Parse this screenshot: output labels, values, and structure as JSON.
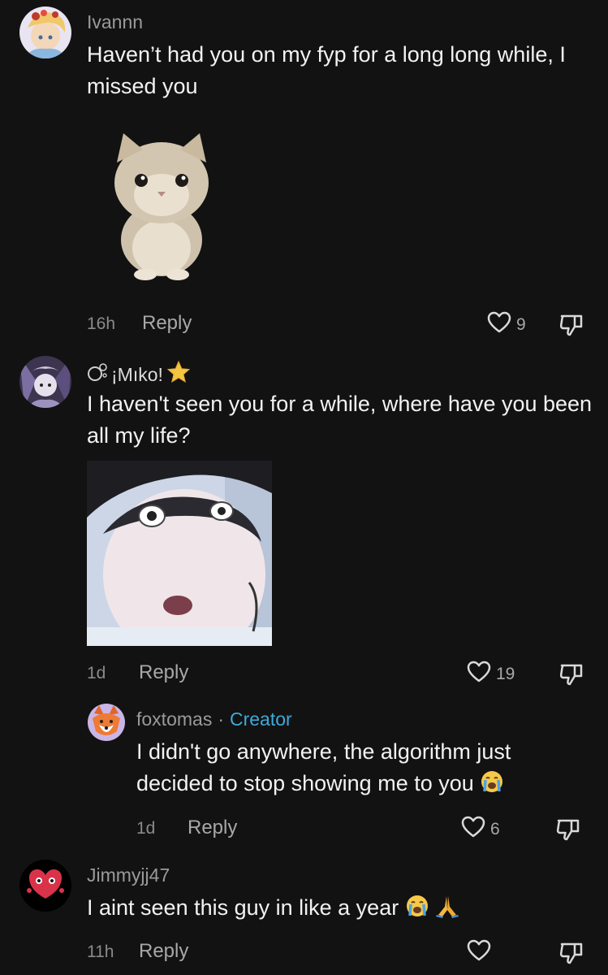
{
  "comments": [
    {
      "username": "Ivannn",
      "text": "Haven’t had you on my fyp for a long long while, I missed you",
      "time": "16h",
      "reply_label": "Reply",
      "likes": "9",
      "sticker": "kitten-sticker"
    },
    {
      "username": "¡Mıko!",
      "username_prefix_icon": "bubbles-icon",
      "username_suffix_icon": "star-icon",
      "text": "I haven't seen you for a while, where have you been all my life?",
      "time": "1d",
      "reply_label": "Reply",
      "likes": "19",
      "image": "surprised-face-photo"
    },
    {
      "username": "foxtomas",
      "separator": "·",
      "badge": "Creator",
      "text": "I didn't go anywhere, the algorithm just decided to stop showing me to you",
      "text_emoji": "crying-face-icon",
      "time": "1d",
      "reply_label": "Reply",
      "likes": "6"
    },
    {
      "username": "Jimmyjj47",
      "text": "I aint seen this guy in like a year",
      "text_emojis": [
        "crying-face-icon",
        "praying-hands-icon"
      ],
      "time": "11h",
      "reply_label": "Reply",
      "likes": ""
    }
  ],
  "colors": {
    "background": "#121212",
    "text": "#f2f2f2",
    "secondary": "#9a9a9a",
    "creator": "#3fa9d8"
  }
}
